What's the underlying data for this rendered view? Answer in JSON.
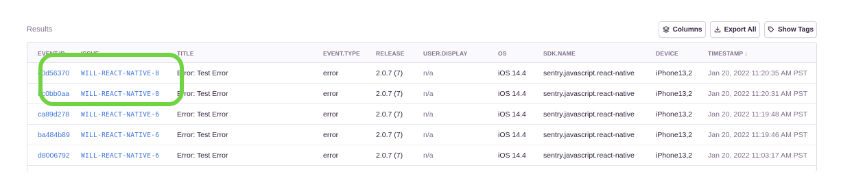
{
  "results_label": "Results",
  "toolbar": {
    "columns_label": "Columns",
    "export_label": "Export All",
    "tags_label": "Show Tags"
  },
  "columns": [
    "EVENT.ID",
    "ISSUE",
    "TITLE",
    "EVENT.TYPE",
    "RELEASE",
    "USER.DISPLAY",
    "OS",
    "SDK.NAME",
    "DEVICE",
    "TIMESTAMP ↓"
  ],
  "rows": [
    {
      "event_id": "c0d56370",
      "issue": "WILL-REACT-NATIVE-8",
      "title": "Error: Test Error",
      "event_type": "error",
      "release": "2.0.7 (7)",
      "user": "n/a",
      "os": "iOS 14.4",
      "sdk": "sentry.javascript.react-native",
      "device": "iPhone13,2",
      "timestamp": "Jan 20, 2022 11:20:35 AM PST"
    },
    {
      "event_id": "8c0bb0aa",
      "issue": "WILL-REACT-NATIVE-8",
      "title": "Error: Test Error",
      "event_type": "error",
      "release": "2.0.7 (7)",
      "user": "n/a",
      "os": "iOS 14.4",
      "sdk": "sentry.javascript.react-native",
      "device": "iPhone13,2",
      "timestamp": "Jan 20, 2022 11:20:31 AM PST"
    },
    {
      "event_id": "ca89d278",
      "issue": "WILL-REACT-NATIVE-6",
      "title": "Error: Test Error",
      "event_type": "error",
      "release": "2.0.7 (7)",
      "user": "n/a",
      "os": "iOS 14.4",
      "sdk": "sentry.javascript.react-native",
      "device": "iPhone13,2",
      "timestamp": "Jan 20, 2022 11:19:48 AM PST"
    },
    {
      "event_id": "ba484b89",
      "issue": "WILL-REACT-NATIVE-6",
      "title": "Error: Test Error",
      "event_type": "error",
      "release": "2.0.7 (7)",
      "user": "n/a",
      "os": "iOS 14.4",
      "sdk": "sentry.javascript.react-native",
      "device": "iPhone13,2",
      "timestamp": "Jan 20, 2022 11:19:46 AM PST"
    },
    {
      "event_id": "d8006792",
      "issue": "WILL-REACT-NATIVE-6",
      "title": "Error: Test Error",
      "event_type": "error",
      "release": "2.0.7 (7)",
      "user": "n/a",
      "os": "iOS 14.4",
      "sdk": "sentry.javascript.react-native",
      "device": "iPhone13,2",
      "timestamp": "Jan 20, 2022 11:03:17 AM PST"
    }
  ],
  "colors": {
    "link": "#3d74db",
    "highlight": "#71d342"
  }
}
